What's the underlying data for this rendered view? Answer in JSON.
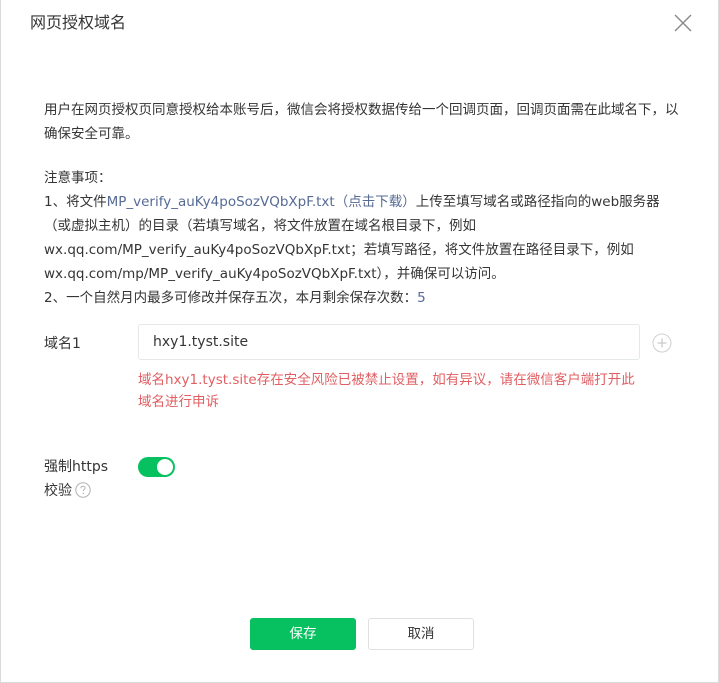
{
  "dialog": {
    "title": "网页授权域名",
    "intro": "用户在网页授权页同意授权给本账号后，微信会将授权数据传给一个回调页面，回调页面需在此域名下，以确保安全可靠。"
  },
  "notes": {
    "heading": "注意事项：",
    "item1_prefix": "1、将文件",
    "item1_filename": "MP_verify_auKy4poSozVQbXpF.txt",
    "item1_download": "（点击下载）",
    "item1_suffix": "上传至填写域名或路径指向的web服务器",
    "item1_line2": "（或虚拟主机）的目录（若填写域名，将文件放置在域名根目录下，例如",
    "item1_line3": "wx.qq.com/MP_verify_auKy4poSozVQbXpF.txt；若填写路径，将文件放置在路径目录下，例如",
    "item1_line4": "wx.qq.com/mp/MP_verify_auKy4poSozVQbXpF.txt），并确保可以访问。",
    "item2_prefix": "2、一个自然月内最多可修改并保存五次，本月剩余保存次数：",
    "item2_count": "5"
  },
  "domain_field": {
    "label": "域名1",
    "value": "hxy1.tyst.site",
    "error": "域名hxy1.tyst.site存在安全风险已被禁止设置，如有异议，请在微信客户端打开此域名进行申诉"
  },
  "https_field": {
    "label_line1": "强制https",
    "label_line2": "校验",
    "enabled": true
  },
  "buttons": {
    "save": "保存",
    "cancel": "取消"
  },
  "colors": {
    "primary": "#07c160",
    "link": "#576b95",
    "error": "#e15f63"
  },
  "icons": {
    "close": "close-icon",
    "add": "plus-circle-icon",
    "help": "question-circle-icon"
  }
}
